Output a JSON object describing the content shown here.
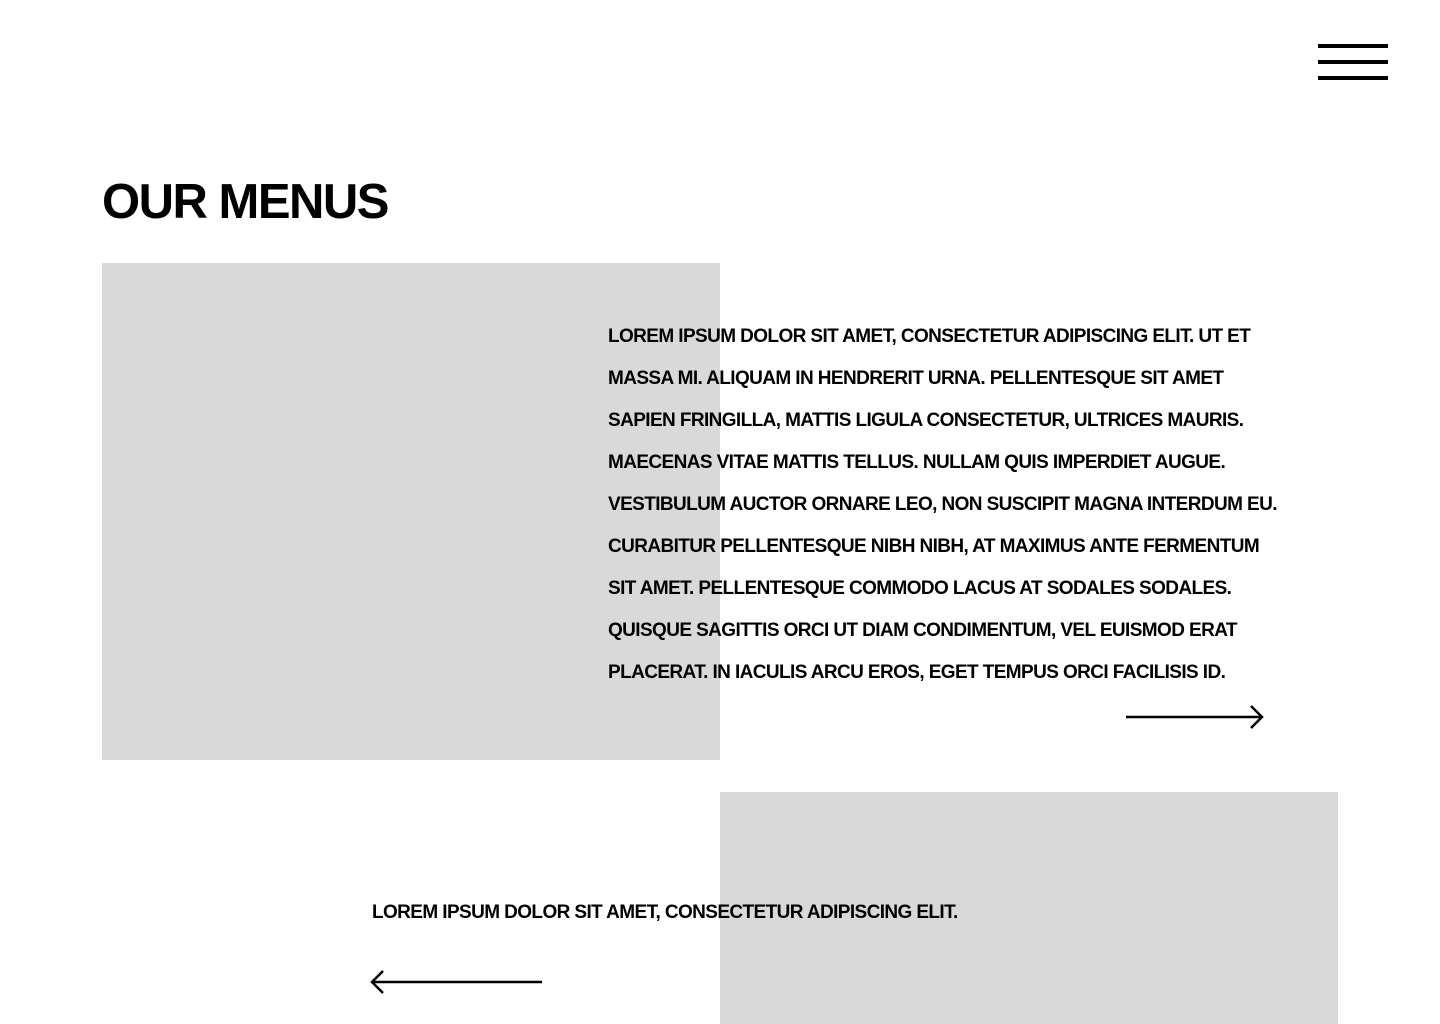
{
  "header": {
    "menu_icon": "hamburger-menu-icon"
  },
  "page": {
    "title": "OUR MENUS"
  },
  "menu_items": [
    {
      "description": "LOREM IPSUM DOLOR SIT AMET, CONSECTETUR ADIPISCING ELIT. UT ET MASSA MI. ALIQUAM IN HENDRERIT URNA. PELLENTESQUE SIT AMET SAPIEN FRINGILLA, MATTIS LIGULA CONSECTETUR, ULTRICES MAURIS. MAECENAS VITAE MATTIS TELLUS. NULLAM QUIS IMPERDIET AUGUE. VESTIBULUM AUCTOR ORNARE LEO, NON SUSCIPIT MAGNA INTERDUM EU. CURABITUR PELLENTESQUE NIBH NIBH, AT MAXIMUS ANTE FERMENTUM SIT AMET. PELLENTESQUE COMMODO LACUS AT SODALES SODALES. QUISQUE SAGITTIS ORCI UT DIAM CONDIMENTUM, VEL EUISMOD ERAT PLACERAT. IN IACULIS ARCU EROS, EGET TEMPUS ORCI FACILISIS ID.",
      "arrow_icon": "arrow-right-icon"
    },
    {
      "description": "LOREM IPSUM DOLOR SIT AMET, CONSECTETUR ADIPISCING ELIT.",
      "arrow_icon": "arrow-left-icon"
    }
  ],
  "colors": {
    "background": "#ffffff",
    "placeholder": "#d9d9d9",
    "text": "#000000"
  }
}
